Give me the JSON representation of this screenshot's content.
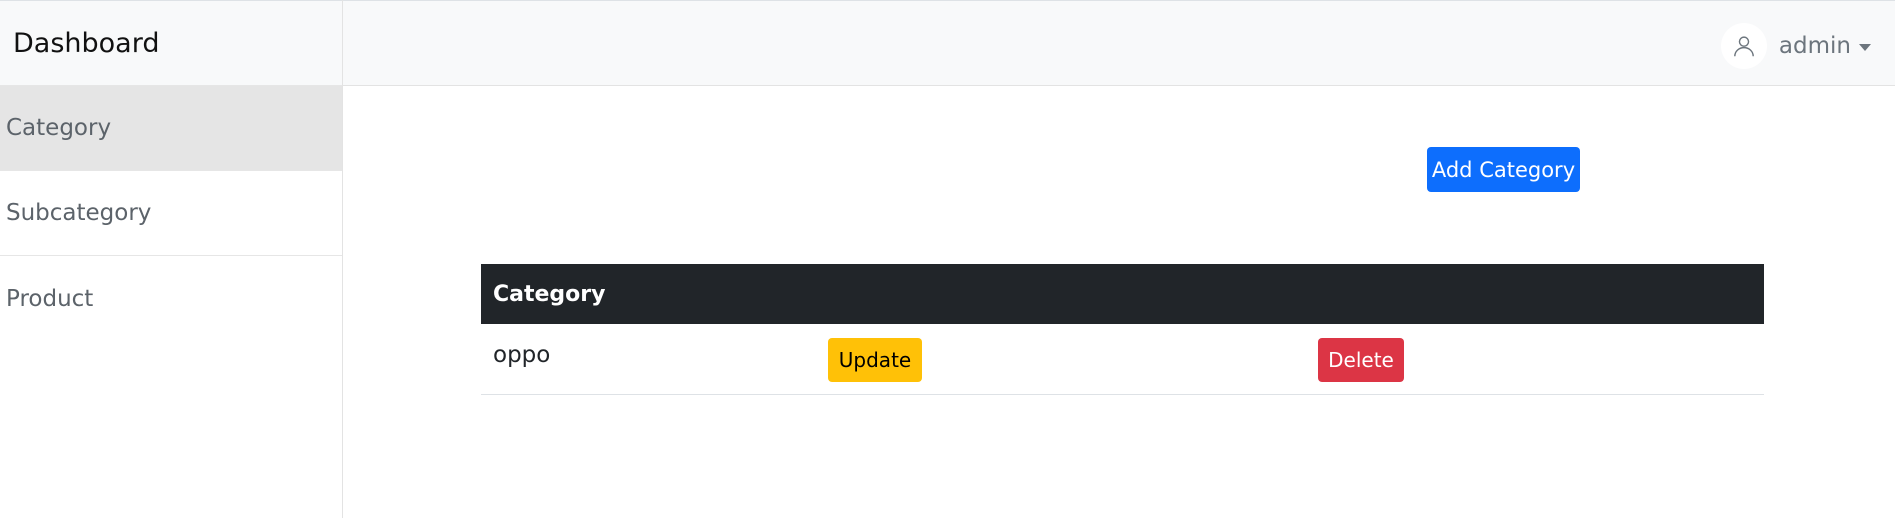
{
  "sidebar": {
    "brand": "Dashboard",
    "items": [
      {
        "label": "Category",
        "active": true
      },
      {
        "label": "Subcategory",
        "active": false
      },
      {
        "label": "Product",
        "active": false
      }
    ]
  },
  "topbar": {
    "user": {
      "name": "admin",
      "avatar_icon": "user-outline-icon",
      "menu_icon": "caret-down-icon"
    }
  },
  "toolbar": {
    "add_label": "Add Category"
  },
  "table": {
    "header": "Category",
    "rows": [
      {
        "name": "oppo",
        "update_label": "Update",
        "delete_label": "Delete"
      }
    ]
  },
  "colors": {
    "primary": "#0d6efd",
    "warning": "#ffc107",
    "danger": "#dc3545",
    "table_header": "#212529",
    "active_item": "#e5e5e5"
  }
}
